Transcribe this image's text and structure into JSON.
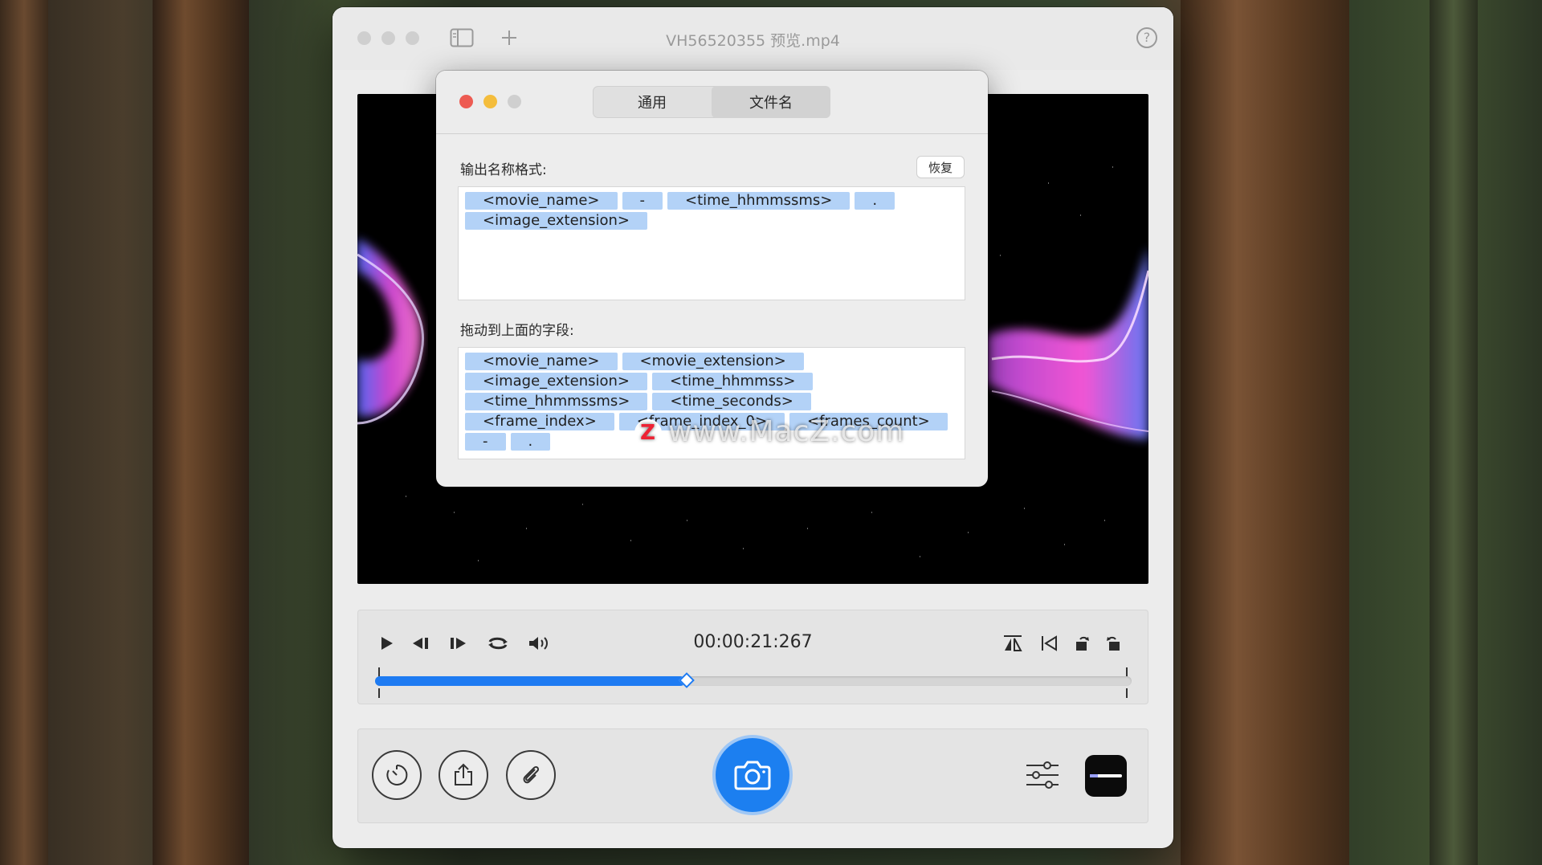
{
  "window": {
    "title": "VH56520355 预览.mp4",
    "help_label": "?"
  },
  "player": {
    "timecode": "00:00:21:267",
    "progress_fraction": 0.41
  },
  "preferences": {
    "tabs": [
      {
        "label": "通用",
        "active": false
      },
      {
        "label": "文件名",
        "active": true
      }
    ],
    "output_format_label": "输出名称格式:",
    "reset_label": "恢复",
    "format_tokens": [
      "<movie_name>",
      "-",
      "<time_hhmmssms>",
      ".",
      "<image_extension>"
    ],
    "fields_label": "拖动到上面的字段:",
    "field_tokens": [
      "<movie_name>",
      "<movie_extension>",
      "<image_extension>",
      "<time_hhmmss>",
      "<time_hhmmssms>",
      "<time_seconds>",
      "<frame_index>",
      "<frame_index_0>",
      "<frames_count>",
      "-",
      "."
    ]
  },
  "watermark": {
    "badge": "Z",
    "text": "www.MacZ.com"
  },
  "colors": {
    "accent": "#1e7bf2",
    "token_bg": "#b3d2f7",
    "close": "#ed5b52",
    "minimize": "#f4bd3c",
    "zoom_disabled": "#cfcfcf"
  },
  "icons": {
    "toolbar": [
      "sidebar-icon",
      "plus-icon",
      "help-icon"
    ],
    "playback": [
      "play-icon",
      "step-back-icon",
      "step-forward-icon",
      "loop-icon",
      "volume-icon"
    ],
    "right": [
      "flip-icon",
      "go-to-start-icon",
      "rotate-left-icon",
      "rotate-right-icon"
    ],
    "bottom": [
      "timer-icon",
      "share-icon",
      "attachment-icon",
      "camera-icon",
      "settings-sliders-icon",
      "app-icon"
    ]
  }
}
